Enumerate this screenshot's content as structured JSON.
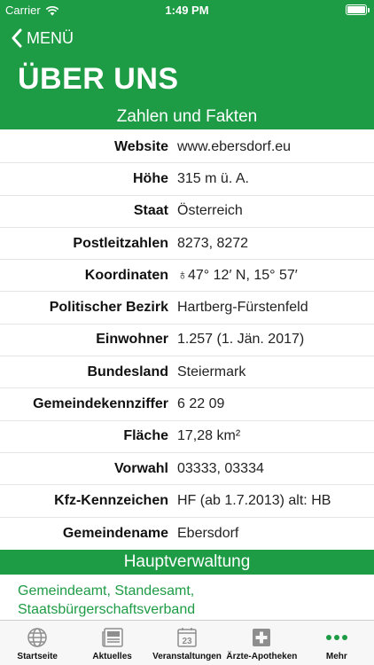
{
  "status_bar": {
    "carrier": "Carrier",
    "time": "1:49 PM"
  },
  "nav": {
    "back_label": "MENÜ",
    "title": "ÜBER UNS"
  },
  "facts_section": {
    "header": "Zahlen und Fakten",
    "rows": [
      {
        "label": "Website",
        "value": "www.ebersdorf.eu"
      },
      {
        "label": "Höhe",
        "value": "315 m ü. A."
      },
      {
        "label": "Staat",
        "value": "Österreich"
      },
      {
        "label": "Postleitzahlen",
        "value": "8273, 8272"
      },
      {
        "label": "Koordinaten",
        "value": "♁47° 12′ N, 15° 57′"
      },
      {
        "label": "Politischer Bezirk",
        "value": "Hartberg-Fürstenfeld"
      },
      {
        "label": "Einwohner",
        "value": "1.257 (1. Jän. 2017)"
      },
      {
        "label": "Bundesland",
        "value": "Steiermark"
      },
      {
        "label": "Gemeindekennziffer",
        "value": "6 22 09"
      },
      {
        "label": "Fläche",
        "value": "17,28 km²"
      },
      {
        "label": "Vorwahl",
        "value": "03333, 03334"
      },
      {
        "label": "Kfz-Kennzeichen",
        "value": "HF (ab 1.7.2013) alt: HB"
      },
      {
        "label": "Gemeindename",
        "value": "Ebersdorf"
      }
    ]
  },
  "admin_section": {
    "header": "Hauptverwaltung",
    "link_text": "Gemeindeamt, Standesamt, Staatsbürgerschaftsverband"
  },
  "tabbar": {
    "tabs": [
      {
        "label": "Startseite",
        "icon": "globe-icon"
      },
      {
        "label": "Aktuelles",
        "icon": "news-icon"
      },
      {
        "label": "Veranstaltungen",
        "icon": "calendar-icon",
        "calendar_day": "23"
      },
      {
        "label": "Ärzte-Apotheken",
        "icon": "medical-cross-icon"
      },
      {
        "label": "Mehr",
        "icon": "more-icon"
      }
    ]
  },
  "colors": {
    "brand_green": "#1e9b45",
    "tab_inactive": "#8e8e8e"
  }
}
